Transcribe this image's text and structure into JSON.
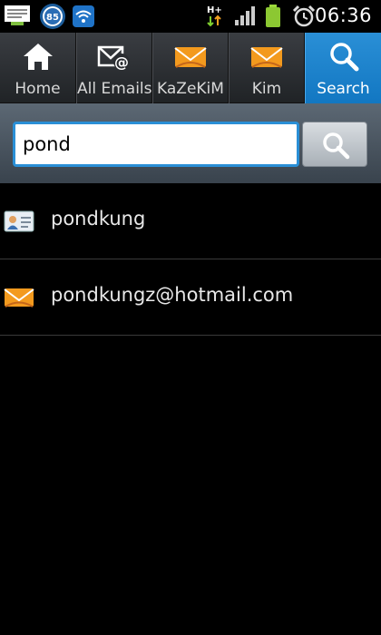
{
  "status_bar": {
    "badge_count": "85",
    "network_type": "H+",
    "time": "06:36",
    "icons": [
      "notes-icon",
      "battery-badge-icon",
      "wifi-app-icon",
      "hplus-data-icon",
      "signal-icon",
      "battery-icon",
      "alarm-icon"
    ]
  },
  "tabs": [
    {
      "label": "Home",
      "icon": "home-icon"
    },
    {
      "label": "All Emails",
      "icon": "all-emails-icon"
    },
    {
      "label": "KaZeKiM",
      "icon": "hotmail-envelope-icon"
    },
    {
      "label": "Kim",
      "icon": "hotmail-envelope-icon"
    },
    {
      "label": "Search",
      "icon": "search-icon",
      "active": true
    }
  ],
  "search": {
    "value": "pond",
    "button_icon": "search-icon"
  },
  "results": [
    {
      "text": "pondkung",
      "icon": "contact-card-icon"
    },
    {
      "text": "pondkungz@hotmail.com",
      "icon": "hotmail-envelope-icon"
    }
  ],
  "colors": {
    "accent": "#1e86cf",
    "hotmail_orange": "#f39a1e",
    "background": "#000000"
  }
}
